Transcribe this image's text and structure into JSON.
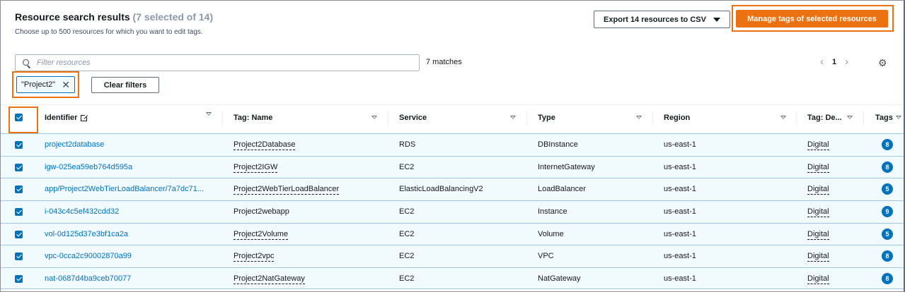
{
  "header": {
    "title": "Resource search results",
    "count_text": "(7 selected of 14)",
    "subtitle": "Choose up to 500 resources for which you want to edit tags.",
    "export_label": "Export 14 resources to CSV",
    "manage_label": "Manage tags of selected resources"
  },
  "filter": {
    "placeholder": "Filter resources",
    "matches": "7 matches",
    "token": "\"Project2\"",
    "clear_label": "Clear filters"
  },
  "pagination": {
    "current": "1"
  },
  "colors": {
    "accent_orange": "#ec7211",
    "link_blue": "#0073bb",
    "selected_row_bg": "#f1faff"
  },
  "icons": [
    "search-icon",
    "close-icon",
    "external-link-icon",
    "chevron-left-icon",
    "chevron-right-icon",
    "gear-icon",
    "caret-down-icon",
    "sort-icon",
    "checkbox-checked-icon"
  ],
  "table": {
    "columns": {
      "identifier": "Identifier",
      "tag_name": "Tag: Name",
      "service": "Service",
      "type": "Type",
      "region": "Region",
      "tag_de": "Tag: De...",
      "tags": "Tags"
    },
    "rows": [
      {
        "identifier": "project2database",
        "name": "Project2Database",
        "service": "RDS",
        "type": "DBInstance",
        "region": "us-east-1",
        "tag_de": "Digital",
        "tags": "8"
      },
      {
        "identifier": "igw-025ea59eb764d595a",
        "name": "Project2IGW",
        "service": "EC2",
        "type": "InternetGateway",
        "region": "us-east-1",
        "tag_de": "Digital",
        "tags": "8"
      },
      {
        "identifier": "app/Project2WebTierLoadBalancer/7a7dc71...",
        "name": "Project2WebTierLoadBalancer",
        "service": "ElasticLoadBalancingV2",
        "type": "LoadBalancer",
        "region": "us-east-1",
        "tag_de": "Digital",
        "tags": "5"
      },
      {
        "identifier": "i-043c4c5ef432cdd32",
        "name": "Project2webapp",
        "service": "EC2",
        "type": "Instance",
        "region": "us-east-1",
        "tag_de": "Digital",
        "tags": "9"
      },
      {
        "identifier": "vol-0d125d37e3bf1ca2a",
        "name": "Project2Volume",
        "service": "EC2",
        "type": "Volume",
        "region": "us-east-1",
        "tag_de": "Digital",
        "tags": "5"
      },
      {
        "identifier": "vpc-0cca2c90002870a99",
        "name": "Project2vpc",
        "service": "EC2",
        "type": "VPC",
        "region": "us-east-1",
        "tag_de": "Digital",
        "tags": "8"
      },
      {
        "identifier": "nat-0687d4ba9ceb70077",
        "name": "Project2NatGateway",
        "service": "EC2",
        "type": "NatGateway",
        "region": "us-east-1",
        "tag_de": "Digital",
        "tags": "8"
      }
    ]
  }
}
